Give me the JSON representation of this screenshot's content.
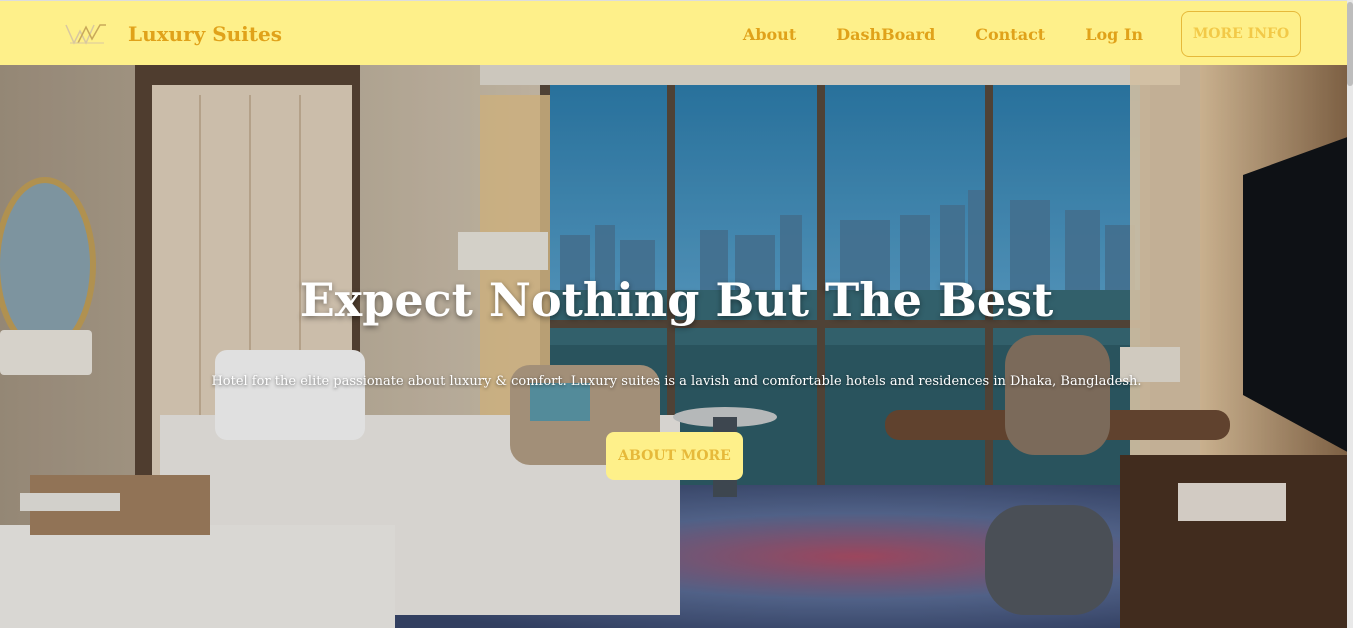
{
  "brand": {
    "name": "Luxury Suites",
    "logo_icon": "crown-logo-icon"
  },
  "nav": {
    "links": [
      "About",
      "DashBoard",
      "Contact",
      "Log In"
    ],
    "more_info": "MORE INFO"
  },
  "hero": {
    "title": "Expect Nothing But The Best",
    "subtitle": "Hotel for the elite passionate about luxury & comfort. Luxury suites is a lavish and comfortable hotels and residences in Dhaka, Bangladesh.",
    "button": "ABOUT MORE",
    "background": "hotel-room-image"
  },
  "colors": {
    "navbar_bg": "#fef08a",
    "accent": "#e0a21a",
    "button_bg": "#fef08a"
  }
}
